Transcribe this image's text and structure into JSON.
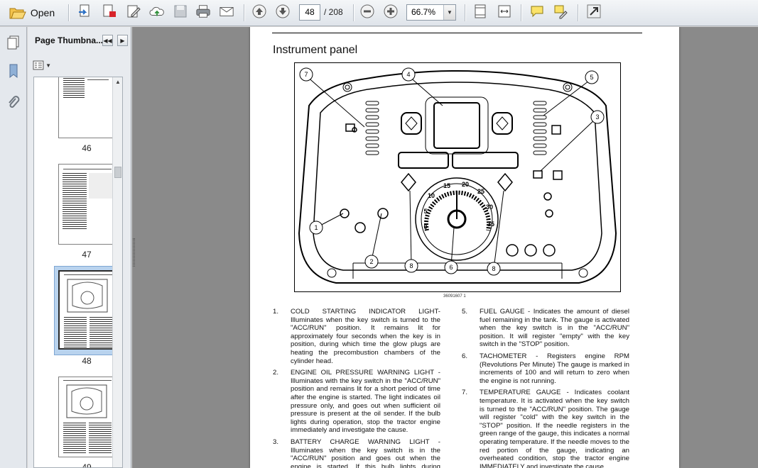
{
  "toolbar": {
    "open_label": "Open",
    "current_page": "48",
    "page_total": "/ 208",
    "zoom": "66.7%",
    "icons": [
      "folder-open-icon",
      "create-pdf-icon",
      "export-pdf-icon",
      "edit-pdf-icon",
      "upload-cloud-icon",
      "save-icon",
      "print-icon",
      "email-icon",
      "previous-page-icon",
      "next-page-icon",
      "zoom-out-icon",
      "zoom-in-icon",
      "fit-page-icon",
      "fit-width-icon",
      "comment-icon",
      "highlight-icon",
      "expand-icon"
    ]
  },
  "sidebar": {
    "rail_icons": [
      "bookmark-icon",
      "attachment-icon"
    ],
    "panel_title": "Page Thumbna...",
    "thumbnails": [
      {
        "label": "46",
        "selected": false
      },
      {
        "label": "47",
        "selected": false
      },
      {
        "label": "48",
        "selected": true
      },
      {
        "label": "49",
        "selected": false
      }
    ]
  },
  "document": {
    "heading": "Instrument panel",
    "figure_caption": "36091607    1",
    "callouts": [
      "1",
      "2",
      "3",
      "4",
      "5",
      "6",
      "7",
      "8",
      "8"
    ],
    "gauge_marks": [
      "0",
      "5",
      "10",
      "15",
      "20",
      "25",
      "30",
      "35"
    ],
    "items_left": [
      {
        "num": "1.",
        "text": "COLD STARTING INDICATOR LIGHT- Illuminates when the key switch is turned to the \"ACC/RUN\" position. It remains lit for approximately four seconds when the key is in position, during which time the glow plugs are heating the precombustion chambers of the cylinder head."
      },
      {
        "num": "2.",
        "text": "ENGINE OIL PRESSURE WARNING LIGHT - Illuminates with the key switch in the \"ACC/RUN\" position and remains lit for a short period of time after the engine is started. The light indicates oil pressure only, and goes out when sufficient oil pressure is present at the oil sender. If the bulb lights during operation, stop the tractor engine immediately and investigate the cause."
      },
      {
        "num": "3.",
        "text": "BATTERY CHARGE WARNING LIGHT - Illuminates when the key switch is in the \"ACC/RUN\" position and goes out when the engine is started. If this bulb lights during operation, it indicates that the charging system is not operating normally. As the"
      }
    ],
    "items_right": [
      {
        "num": "5.",
        "text": "FUEL GAUGE - Indicates the amount of diesel fuel remaining in the tank. The gauge is activated when the key switch is in the \"ACC/RUN\" position. It will register \"empty\" with the key switch in the \"STOP\" position."
      },
      {
        "num": "6.",
        "text": "TACHOMETER - Registers engine RPM (Revolutions Per Minute) The gauge is marked in increments of 100 and will return to zero when the engine is not running."
      },
      {
        "num": "7.",
        "text": "TEMPERATURE GAUGE - Indicates coolant temperature. It is activated when the key switch is turned to the \"ACC/RUN\" position. The gauge will register \"cold\" with the key switch in the \"STOP\" position. If the needle registers in the green range of the gauge, this indicates a normal operating temperature. If the needle moves to the red portion of the gauge, indicating an overheated condition, stop the tractor engine IMMEDIATELY and investigate the cause."
      }
    ]
  }
}
